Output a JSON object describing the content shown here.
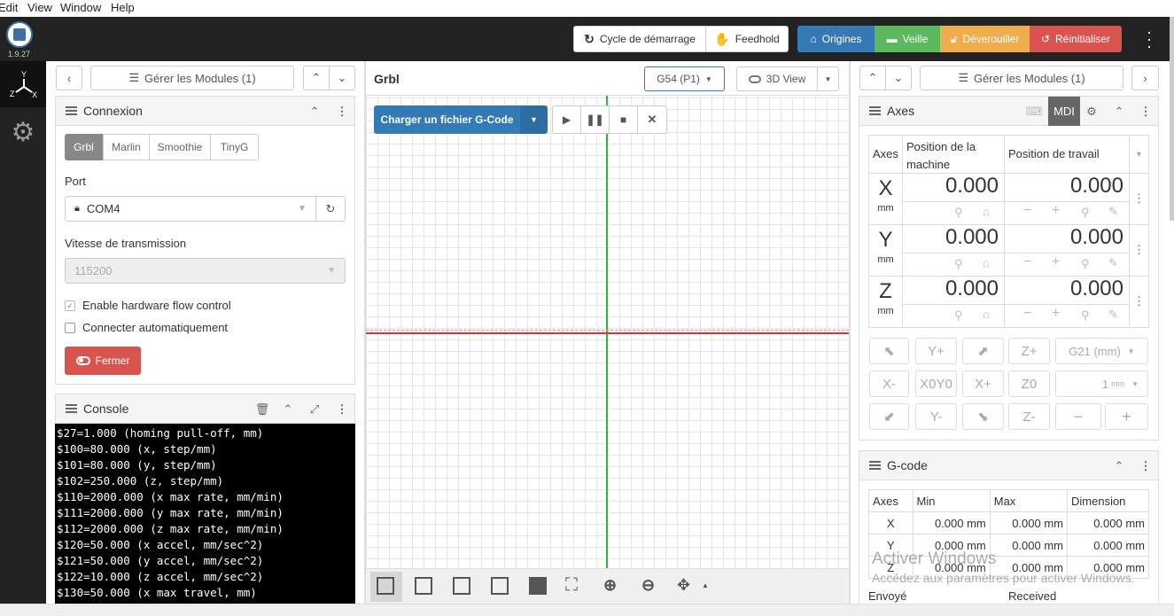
{
  "menubar": {
    "items": [
      "Edit",
      "View",
      "Window",
      "Help"
    ]
  },
  "header": {
    "version": "1.9.27",
    "cycle_start": "Cycle de démarrage",
    "feedhold": "Feedhold",
    "homing": "Origines",
    "sleep": "Veille",
    "unlock": "Déverouiller",
    "reset": "Réinitialiser",
    "colors": {
      "homing": "#337ab7",
      "sleep": "#5cb85c",
      "unlock": "#f0ad4e",
      "reset": "#d9534f"
    }
  },
  "left": {
    "manage_modules": "Gérer les Modules (1)",
    "connection": {
      "title": "Connexion",
      "tabs": [
        "Grbl",
        "Marlin",
        "Smoothie",
        "TinyG"
      ],
      "port_label": "Port",
      "port_value": "COM4",
      "baud_label": "Vitesse de transmission",
      "baud_value": "115200",
      "hw_flow": "Enable hardware flow control",
      "auto_connect": "Connecter automatiquement",
      "close_button": "Fermer"
    },
    "console": {
      "title": "Console",
      "lines": [
        "$27=1.000 (homing pull-off, mm)",
        "$100=80.000 (x, step/mm)",
        "$101=80.000 (y, step/mm)",
        "$102=250.000 (z, step/mm)",
        "$110=2000.000 (x max rate, mm/min)",
        "$111=2000.000 (y max rate, mm/min)",
        "$112=2000.000 (z max rate, mm/min)",
        "$120=50.000 (x accel, mm/sec^2)",
        "$121=50.000 (y accel, mm/sec^2)",
        "$122=10.000 (z accel, mm/sec^2)",
        "$130=50.000 (x max travel, mm)"
      ]
    }
  },
  "center": {
    "title": "Grbl",
    "wcs": "G54 (P1)",
    "view3d": "3D View",
    "load_gcode": "Charger un fichier G-Code"
  },
  "right": {
    "manage_modules": "Gérer les Modules (1)",
    "axes": {
      "title": "Axes",
      "mdi": "MDI",
      "col_axes": "Axes",
      "col_machine": "Position de la machine",
      "col_work": "Position de travail",
      "rows": [
        {
          "axis": "X",
          "unit": "mm",
          "machine": "0.000",
          "work": "0.000"
        },
        {
          "axis": "Y",
          "unit": "mm",
          "machine": "0.000",
          "work": "0.000"
        },
        {
          "axis": "Z",
          "unit": "mm",
          "machine": "0.000",
          "work": "0.000"
        }
      ],
      "jog": {
        "yplus": "Y+",
        "zplus": "Z+",
        "units": "G21 (mm)",
        "xminus": "X-",
        "x0y0": "X0Y0",
        "xplus": "X+",
        "z0": "Z0",
        "step": "1",
        "step_unit": "mm",
        "yminus": "Y-",
        "zminus": "Z-"
      }
    },
    "gcode": {
      "title": "G-code",
      "headers": [
        "Axes",
        "Min",
        "Max",
        "Dimension"
      ],
      "rows": [
        [
          "X",
          "0.000 mm",
          "0.000 mm",
          "0.000 mm"
        ],
        [
          "Y",
          "0.000 mm",
          "0.000 mm",
          "0.000 mm"
        ],
        [
          "Z",
          "0.000 mm",
          "0.000 mm",
          "0.000 mm"
        ]
      ],
      "sent": "Envoyé",
      "received": "Received"
    }
  },
  "watermark": {
    "line1": "Activer Windows",
    "line2": "Accédez aux paramètres pour activer Windows."
  }
}
